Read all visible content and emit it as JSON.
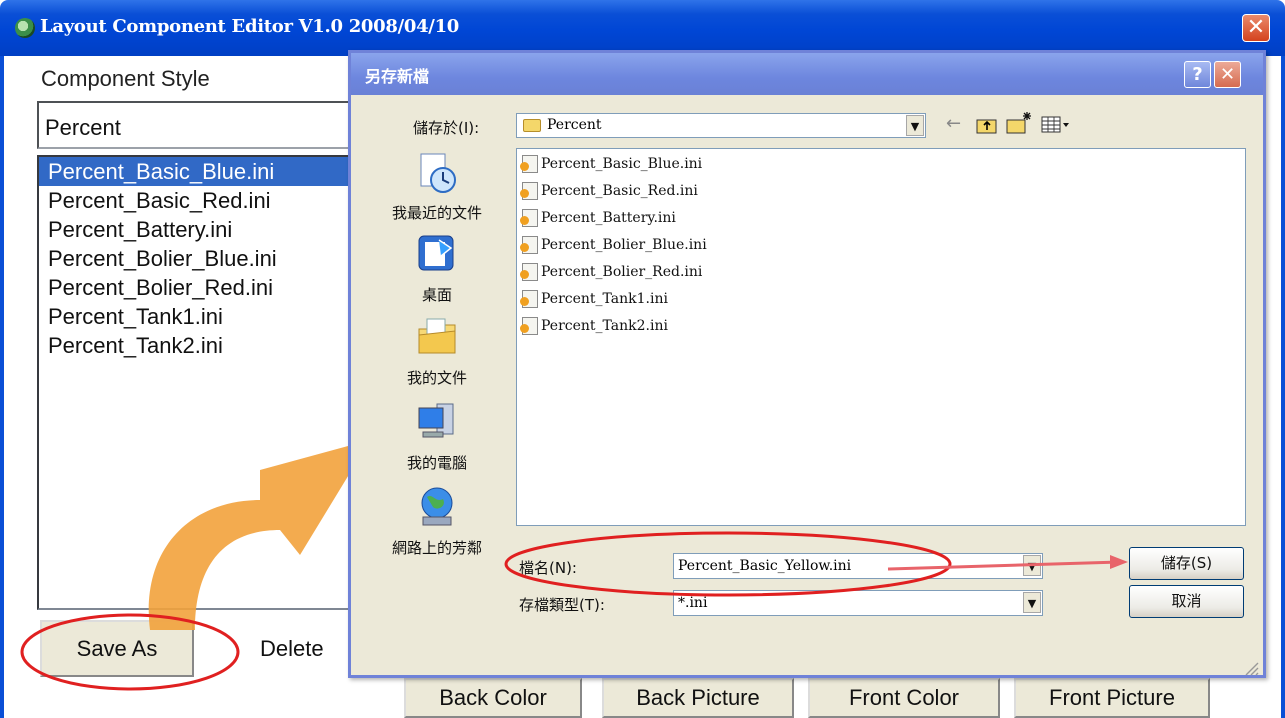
{
  "main_window": {
    "title": "Layout Component Editor V1.0  2008/04/10",
    "close_glyph": "✕",
    "component_style_label": "Component Style",
    "component_style_value": "Percent",
    "style_list": [
      {
        "label": "Percent_Basic_Blue.ini",
        "selected": true
      },
      {
        "label": "Percent_Basic_Red.ini",
        "selected": false
      },
      {
        "label": "Percent_Battery.ini",
        "selected": false
      },
      {
        "label": "Percent_Bolier_Blue.ini",
        "selected": false
      },
      {
        "label": "Percent_Bolier_Red.ini",
        "selected": false
      },
      {
        "label": "Percent_Tank1.ini",
        "selected": false
      },
      {
        "label": "Percent_Tank2.ini",
        "selected": false
      }
    ],
    "buttons": {
      "save_as": "Save As",
      "delete": "Delete",
      "back_color": "Back Color",
      "back_picture": "Back Picture",
      "front_color": "Front Color",
      "front_picture": "Front Picture"
    }
  },
  "dialog": {
    "title": "另存新檔",
    "help_glyph": "?",
    "close_glyph": "✕",
    "save_in_label": "儲存於(I):",
    "save_in_value": "Percent",
    "toolbar_icons": [
      "back-arrow-icon",
      "up-folder-icon",
      "new-folder-icon",
      "view-menu-icon"
    ],
    "places": [
      {
        "label": "我最近的文件",
        "icon": "recent-documents-icon"
      },
      {
        "label": "桌面",
        "icon": "desktop-icon"
      },
      {
        "label": "我的文件",
        "icon": "my-documents-icon"
      },
      {
        "label": "我的電腦",
        "icon": "my-computer-icon"
      },
      {
        "label": "網路上的芳鄰",
        "icon": "network-places-icon"
      }
    ],
    "files": [
      "Percent_Basic_Blue.ini",
      "Percent_Basic_Red.ini",
      "Percent_Battery.ini",
      "Percent_Bolier_Blue.ini",
      "Percent_Bolier_Red.ini",
      "Percent_Tank1.ini",
      "Percent_Tank2.ini"
    ],
    "filename_label": "檔名(N):",
    "filename_value": "Percent_Basic_Yellow.ini",
    "filetype_label": "存檔類型(T):",
    "filetype_value": "*.ini",
    "save_button": "儲存(S)",
    "cancel_button": "取消"
  },
  "annotations": {
    "highlight_color": "#e02020",
    "big_arrow_color": "#f2a23c"
  }
}
